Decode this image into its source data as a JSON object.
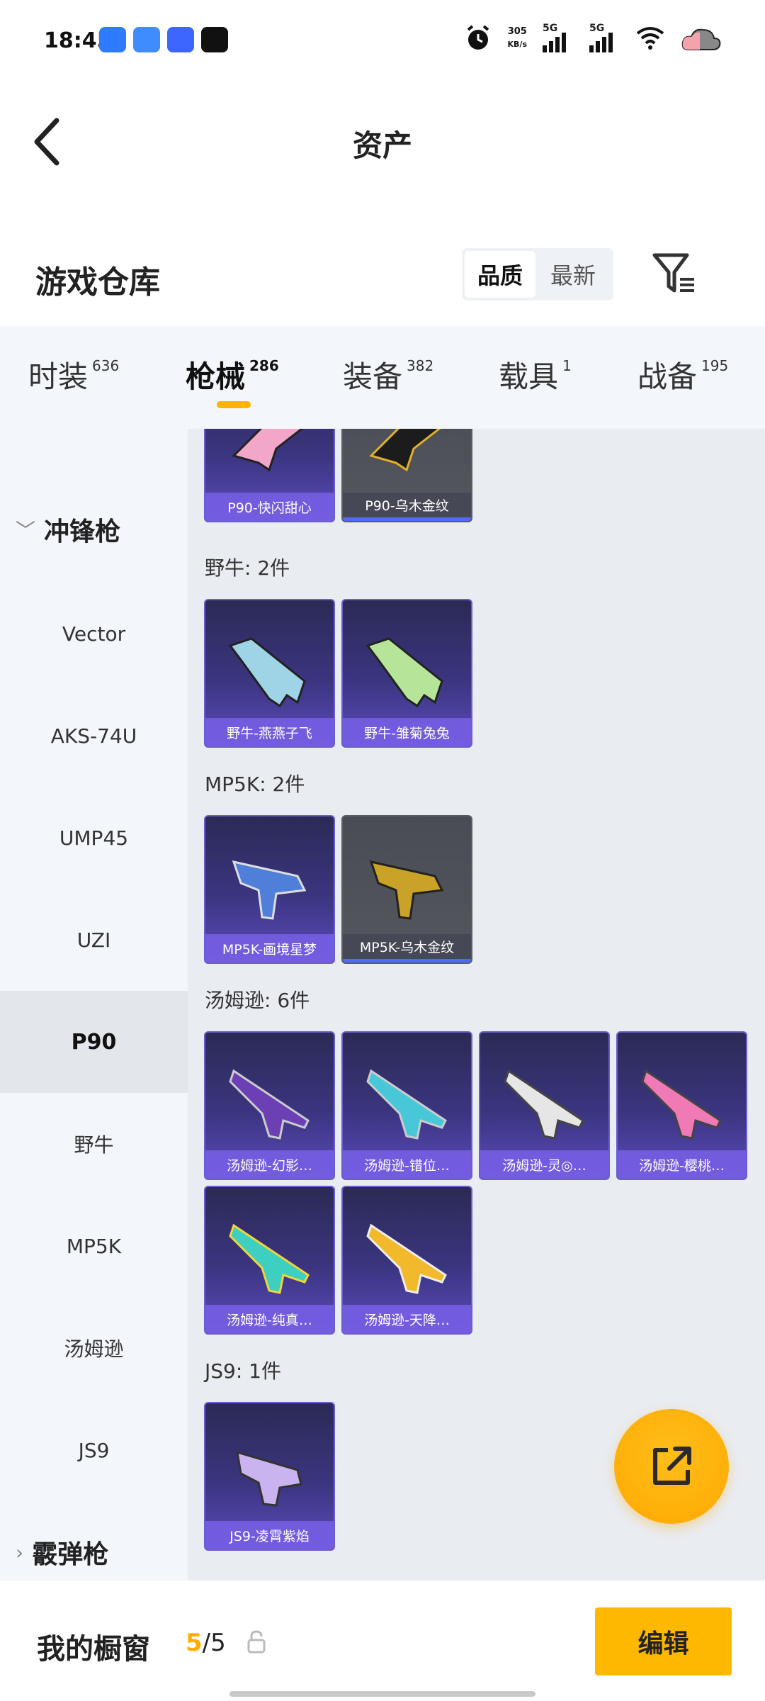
{
  "status_bar": {
    "time": "18:45",
    "net_speed_value": "305",
    "net_speed_unit": "KB/s",
    "signal1_label": "5G",
    "signal2_label": "5G",
    "app_colors": [
      "#2f7bff",
      "#3f8cff",
      "#3c66ff",
      "#111111"
    ]
  },
  "header": {
    "title": "资产"
  },
  "warehouse": {
    "title": "游戏仓库",
    "sort_options": [
      "品质",
      "最新"
    ],
    "sort_selected": "品质"
  },
  "tabs": [
    {
      "label": "时装",
      "count": "636"
    },
    {
      "label": "枪械",
      "count": "286",
      "active": true
    },
    {
      "label": "装备",
      "count": "382"
    },
    {
      "label": "载具",
      "count": "1"
    },
    {
      "label": "战备",
      "count": "195"
    }
  ],
  "sidebar": {
    "group_open": "冲锋枪",
    "items": [
      "Vector",
      "AKS-74U",
      "UMP45",
      "UZI",
      "P90",
      "野牛",
      "MP5K",
      "汤姆逊",
      "JS9"
    ],
    "active_item": "P90",
    "group_closed": "霰弹枪"
  },
  "content": {
    "p90_cards": [
      "P90-快闪甜心",
      "P90-乌木金纹"
    ],
    "bison_label": "野牛: 2件",
    "bison_cards": [
      "野牛-燕燕子飞",
      "野牛-雏菊兔兔"
    ],
    "mp5k_label": "MP5K: 2件",
    "mp5k_cards": [
      "MP5K-画境星梦",
      "MP5K-乌木金纹"
    ],
    "thompson_label": "汤姆逊: 6件",
    "thompson_cards": [
      "汤姆逊-幻影…",
      "汤姆逊-错位…",
      "汤姆逊-灵◎…",
      "汤姆逊-樱桃…",
      "汤姆逊-纯真…",
      "汤姆逊-天降…"
    ],
    "js9_label": "JS9: 1件",
    "js9_cards": [
      "JS9-凌霄紫焰"
    ]
  },
  "bottom": {
    "showcase_label": "我的橱窗",
    "count_used": "5",
    "count_sep": "/",
    "count_total": "5",
    "edit_label": "编辑"
  },
  "colors": {
    "accent": "#ffb400",
    "card_purple": "#3b3580",
    "card_gray": "#55575f"
  }
}
